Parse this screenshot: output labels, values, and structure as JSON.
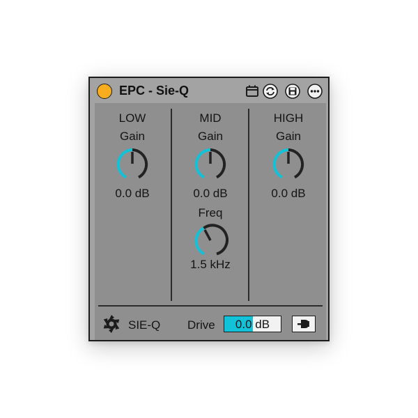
{
  "device": {
    "title": "EPC - Sie-Q",
    "title_icons": [
      "calendar-icon",
      "sync-icon",
      "save-icon",
      "more-icon"
    ]
  },
  "bands": {
    "low": {
      "name": "LOW",
      "gain_label": "Gain",
      "gain_value": "0.0 dB"
    },
    "mid": {
      "name": "MID",
      "gain_label": "Gain",
      "gain_value": "0.0 dB",
      "freq_label": "Freq",
      "freq_value": "1.5 kHz"
    },
    "high": {
      "name": "HIGH",
      "gain_label": "Gain",
      "gain_value": "0.0 dB"
    }
  },
  "footer": {
    "brand": "SIE-Q",
    "drive_label": "Drive",
    "drive_number": "0.0",
    "drive_unit": "dB",
    "drive_fill_fraction": 0.5
  },
  "colors": {
    "accent": "#11c2d8",
    "power": "#f7ad1d",
    "panel": "#8f8f8f",
    "frame": "#a3a3a3"
  }
}
